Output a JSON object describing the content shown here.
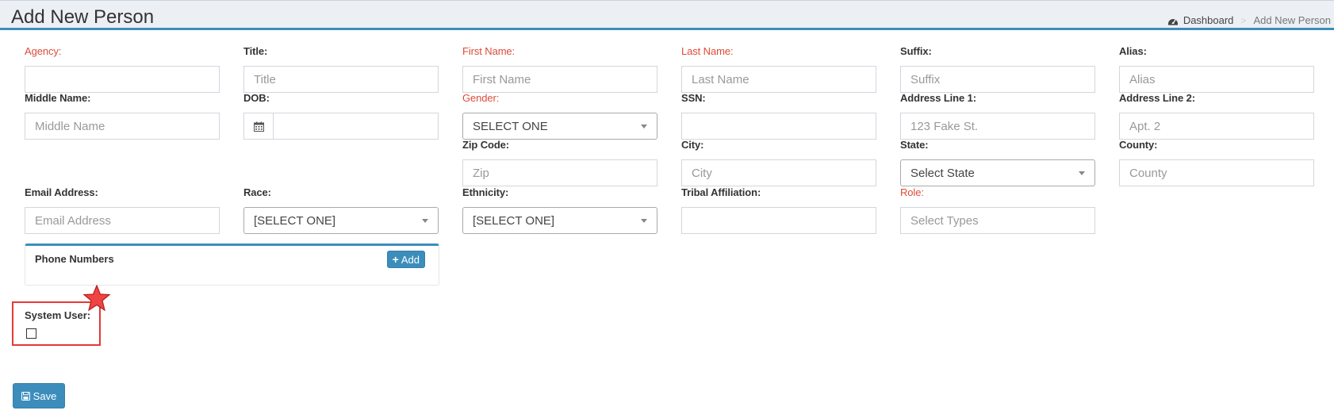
{
  "header": {
    "title": "Add New Person",
    "breadcrumb": {
      "dashboard": "Dashboard",
      "current": "Add New Person"
    }
  },
  "form": {
    "agency": {
      "label": "Agency:",
      "value": "",
      "placeholder": ""
    },
    "title": {
      "label": "Title:",
      "placeholder": "Title"
    },
    "first_name": {
      "label": "First Name:",
      "placeholder": "First Name"
    },
    "last_name": {
      "label": "Last Name:",
      "placeholder": "Last Name"
    },
    "suffix": {
      "label": "Suffix:",
      "placeholder": "Suffix"
    },
    "alias": {
      "label": "Alias:",
      "placeholder": "Alias"
    },
    "middle_name": {
      "label": "Middle Name:",
      "placeholder": "Middle Name"
    },
    "dob": {
      "label": "DOB:",
      "value": ""
    },
    "gender": {
      "label": "Gender:",
      "selected": "SELECT ONE"
    },
    "ssn": {
      "label": "SSN:",
      "value": ""
    },
    "address1": {
      "label": "Address Line 1:",
      "placeholder": "123 Fake St."
    },
    "address2": {
      "label": "Address Line 2:",
      "placeholder": "Apt. 2"
    },
    "zip": {
      "label": "Zip Code:",
      "placeholder": "Zip"
    },
    "city": {
      "label": "City:",
      "placeholder": "City"
    },
    "state": {
      "label": "State:",
      "selected": "Select State"
    },
    "county": {
      "label": "County:",
      "placeholder": "County"
    },
    "email": {
      "label": "Email Address:",
      "placeholder": "Email Address"
    },
    "race": {
      "label": "Race:",
      "selected": "[SELECT ONE]"
    },
    "ethnicity": {
      "label": "Ethnicity:",
      "selected": "[SELECT ONE]"
    },
    "tribal": {
      "label": "Tribal Affiliation:",
      "value": ""
    },
    "role": {
      "label": "Role:",
      "placeholder": "Select Types"
    }
  },
  "phone_numbers": {
    "title": "Phone Numbers",
    "add_label": "Add"
  },
  "system_user": {
    "label": "System User:",
    "checked": false
  },
  "actions": {
    "save_label": "Save"
  },
  "colors": {
    "primary": "#3c8dbc",
    "required": "#dd4b39",
    "header_bg": "#ecf0f5",
    "highlight": "#e53935"
  },
  "icons": [
    "dashboard-icon",
    "calendar-icon",
    "plus-icon",
    "floppy-disk-icon",
    "star-icon",
    "caret-down-icon"
  ]
}
